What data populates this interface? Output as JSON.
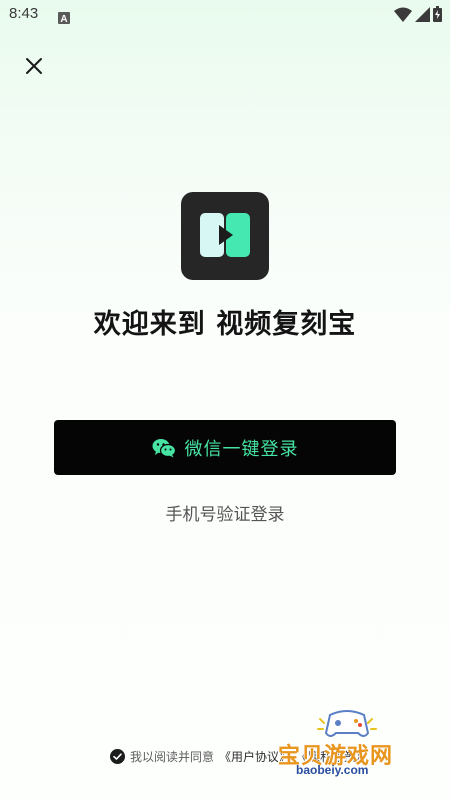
{
  "status_bar": {
    "time": "8:43",
    "notification_letter": "A",
    "icons": [
      "wifi-icon",
      "signal-icon",
      "battery-icon"
    ]
  },
  "close_icon": "close-icon",
  "welcome": {
    "title": "欢迎来到 视频复刻宝"
  },
  "wechat_login": {
    "label": "微信一键登录",
    "icon": "wechat-icon"
  },
  "phone_login": {
    "label": "手机号验证登录"
  },
  "agreement": {
    "prefix": "我以阅读并同意",
    "user_agreement": "《用户协议》",
    "privacy_policy": "《隐私政策》"
  },
  "watermark": {
    "text": "宝贝游戏网",
    "url": "baobeiy.com"
  },
  "colors": {
    "accent": "#46e3a3",
    "button_bg": "#050505",
    "watermark": "#e8961e"
  }
}
